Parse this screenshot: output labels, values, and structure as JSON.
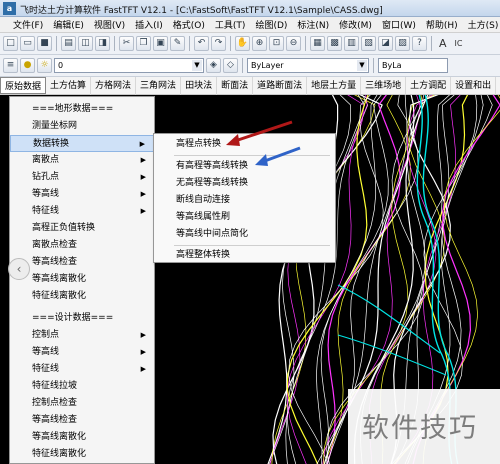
{
  "window": {
    "title": "飞时达土方计算软件 FastTFT V12.1 - [C:\\FastSoft\\FastTFT V12.1\\Sample\\CASS.dwg]",
    "app_icon_letter": "a"
  },
  "menubar": {
    "items": [
      "文件(F)",
      "编辑(E)",
      "视图(V)",
      "插入(I)",
      "格式(O)",
      "工具(T)",
      "绘图(D)",
      "标注(N)",
      "修改(M)",
      "窗口(W)",
      "帮助(H)",
      "土方(S)"
    ]
  },
  "toolbar1": {
    "text_style_glyph": "A",
    "text_style_label": "IC"
  },
  "toolbar2": {
    "layer_value": "0",
    "color_value": "ByLayer",
    "linetype_value": "ByLa"
  },
  "funcbar": {
    "tabs": [
      "原始数据",
      "土方估算",
      "方格网法",
      "三角网法",
      "田块法",
      "断面法",
      "道路断面法",
      "地层土方量",
      "三维场地",
      "土方调配",
      "设置和出"
    ],
    "active_index": 0
  },
  "main_menu": {
    "items": [
      {
        "label": "===地形数据===",
        "has_sub": false
      },
      {
        "label": "测量坐标网",
        "has_sub": false
      },
      {
        "label": "数据转换",
        "has_sub": true,
        "hover": true
      },
      {
        "label": "离散点",
        "has_sub": true
      },
      {
        "label": "钻孔点",
        "has_sub": true
      },
      {
        "label": "等高线",
        "has_sub": true
      },
      {
        "label": "特征线",
        "has_sub": true
      },
      {
        "label": "高程正负值转换",
        "has_sub": false
      },
      {
        "label": "离散点检查",
        "has_sub": false
      },
      {
        "label": "等高线检查",
        "has_sub": false
      },
      {
        "label": "等高线离散化",
        "has_sub": false
      },
      {
        "label": "特征线离散化",
        "has_sub": false
      },
      {
        "label": "===设计数据===",
        "has_sub": false
      },
      {
        "label": "控制点",
        "has_sub": true
      },
      {
        "label": "等高线",
        "has_sub": true
      },
      {
        "label": "特征线",
        "has_sub": true
      },
      {
        "label": "特征线拉坡",
        "has_sub": false
      },
      {
        "label": "控制点检查",
        "has_sub": false
      },
      {
        "label": "等高线检查",
        "has_sub": false
      },
      {
        "label": "等高线离散化",
        "has_sub": false
      },
      {
        "label": "特征线离散化",
        "has_sub": false
      }
    ]
  },
  "sub_menu": {
    "items": [
      "高程点转换",
      "有高程等高线转换",
      "无高程等高线转换",
      "断线自动连接",
      "等高线属性刷",
      "等高线中间点简化",
      "高程整体转换"
    ]
  },
  "colors": {
    "drawing_bg": "#000000",
    "contour_white": "#ffffff",
    "contour_cyan": "#00e5e5",
    "contour_magenta": "#ff33ff",
    "contour_yellow": "#ffff33",
    "arrow_red": "#b01818",
    "arrow_blue": "#2f63c8"
  },
  "watermark": {
    "text": "软件技巧"
  }
}
